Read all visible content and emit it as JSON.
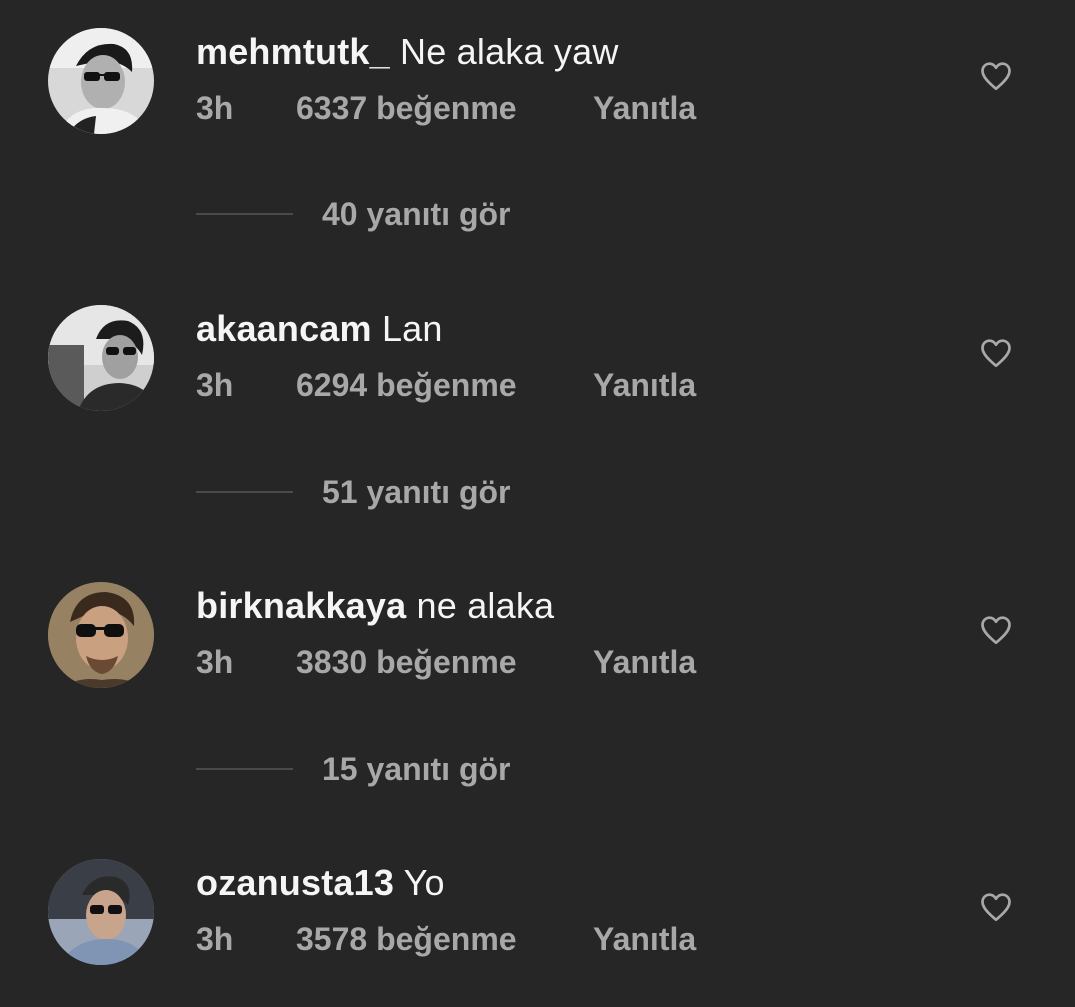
{
  "comments": [
    {
      "username": "mehmtutk_",
      "text": "Ne alaka yaw",
      "time": "3h",
      "likes": "6337 beğenme",
      "reply_label": "Yanıtla",
      "view_replies": "40 yanıtı gör",
      "avatar_icon": "profile-photo"
    },
    {
      "username": "akaancam",
      "text": "Lan",
      "time": "3h",
      "likes": "6294 beğenme",
      "reply_label": "Yanıtla",
      "view_replies": "51 yanıtı gör",
      "avatar_icon": "profile-photo"
    },
    {
      "username": "birknakkaya",
      "text": "ne alaka",
      "time": "3h",
      "likes": "3830 beğenme",
      "reply_label": "Yanıtla",
      "view_replies": "15 yanıtı gör",
      "avatar_icon": "profile-photo"
    },
    {
      "username": "ozanusta13",
      "text": "Yo",
      "time": "3h",
      "likes": "3578 beğenme",
      "reply_label": "Yanıtla",
      "avatar_icon": "profile-photo"
    }
  ],
  "icons": {
    "like": "heart-outline-icon"
  },
  "colors": {
    "background": "#262626",
    "primary_text": "#f5f5f5",
    "secondary_text": "#a8a8a8",
    "divider": "#4a4a4a"
  }
}
